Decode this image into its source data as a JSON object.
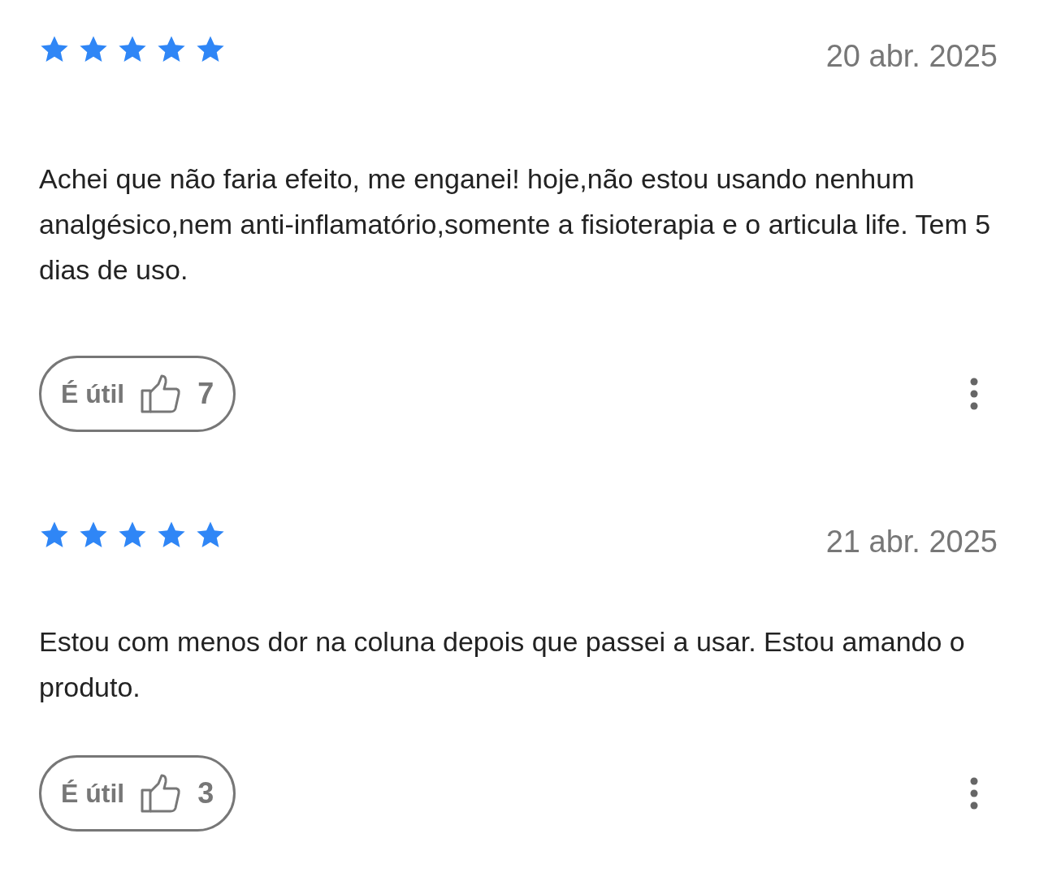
{
  "reviews": [
    {
      "stars": 5,
      "date": "20 abr. 2025",
      "text": "Achei que não faria efeito, me enganei! hoje,não estou usando nenhum analgésico,nem anti-inflamatório,somente a fisioterapia e o articula life. Tem 5 dias de uso.",
      "helpful_label": "É útil",
      "helpful_count": "7"
    },
    {
      "stars": 5,
      "date": "21 abr. 2025",
      "text": "Estou com menos dor na coluna depois que passei a usar. Estou amando o produto.",
      "helpful_label": "É útil",
      "helpful_count": "3"
    }
  ]
}
